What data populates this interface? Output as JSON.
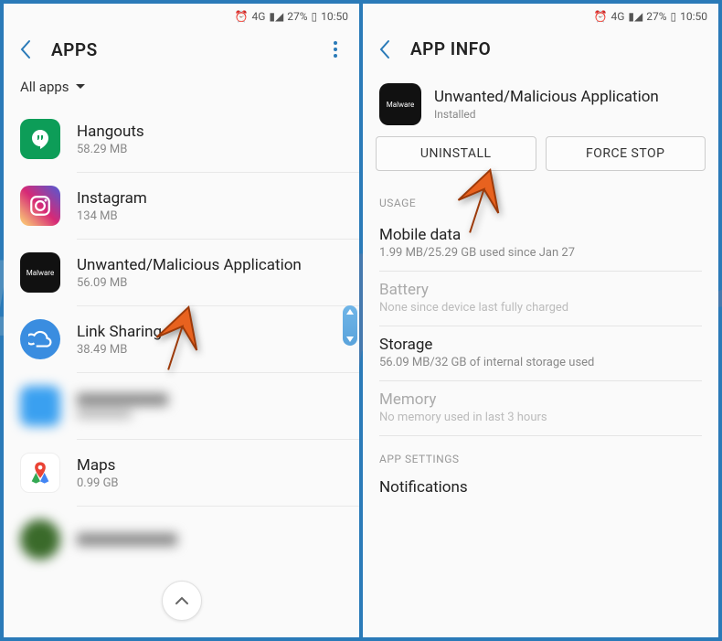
{
  "status": {
    "network": "4G",
    "battery_pct": "27%",
    "time": "10:50"
  },
  "left": {
    "header_title": "APPS",
    "filter_label": "All apps",
    "apps": [
      {
        "name": "Hangouts",
        "size": "58.29 MB"
      },
      {
        "name": "Instagram",
        "size": "134 MB"
      },
      {
        "name": "Unwanted/Malicious Application",
        "size": "56.09 MB"
      },
      {
        "name": "Link Sharing",
        "size": "38.49 MB"
      },
      {
        "name": "",
        "size": ""
      },
      {
        "name": "Maps",
        "size": "0.99 GB"
      },
      {
        "name": "",
        "size": ""
      }
    ],
    "malware_icon_text": "Malware"
  },
  "right": {
    "header_title": "APP INFO",
    "app_name": "Unwanted/Malicious Application",
    "app_status": "Installed",
    "malware_icon_text": "Malware",
    "uninstall_label": "UNINSTALL",
    "forcestop_label": "FORCE STOP",
    "usage_header": "USAGE",
    "mobile_data": {
      "title": "Mobile data",
      "sub": "1.99 MB/25.29 GB used since Jan 27"
    },
    "battery": {
      "title": "Battery",
      "sub": "None since device last fully charged"
    },
    "storage": {
      "title": "Storage",
      "sub": "56.09 MB/32 GB of internal storage used"
    },
    "memory": {
      "title": "Memory",
      "sub": "No memory used in last 3 hours"
    },
    "app_settings_header": "APP SETTINGS",
    "notifications_title": "Notifications"
  }
}
